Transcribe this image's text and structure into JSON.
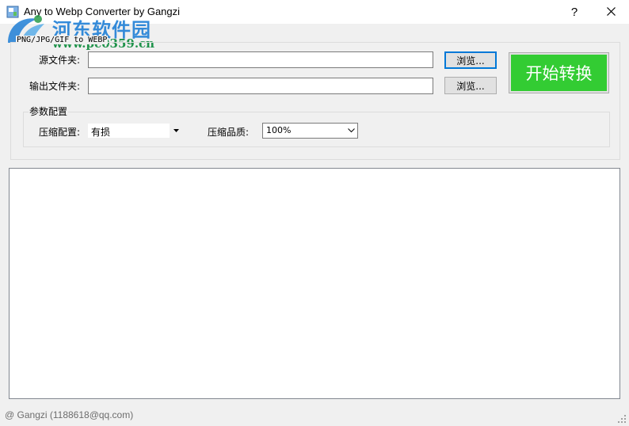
{
  "window": {
    "title": "Any to Webp Converter by Gangzi",
    "help_label": "?",
    "close_label": "✕"
  },
  "watermark": {
    "site_name": "河东软件园",
    "site_url": "www.pc0359.cn"
  },
  "main_group": {
    "legend": "PNG/JPG/GIF to WEBP",
    "source_label": "源文件夹:",
    "source_value": "",
    "source_browse": "浏览...",
    "output_label": "输出文件夹:",
    "output_value": "",
    "output_browse": "浏览...",
    "start_button": "开始转换"
  },
  "params_group": {
    "legend": "参数配置",
    "compress_mode_label": "压缩配置:",
    "compress_mode_value": "有损",
    "quality_label": "压缩品质:",
    "quality_value": "100%"
  },
  "log_list": {
    "items": []
  },
  "status": {
    "text": "@ Gangzi (1188618@qq.com)"
  },
  "colors": {
    "start_button_bg": "#33cc33",
    "focus_border": "#0078d7",
    "watermark_blue": "#1f7fd6",
    "watermark_green": "#0a8a3a"
  }
}
